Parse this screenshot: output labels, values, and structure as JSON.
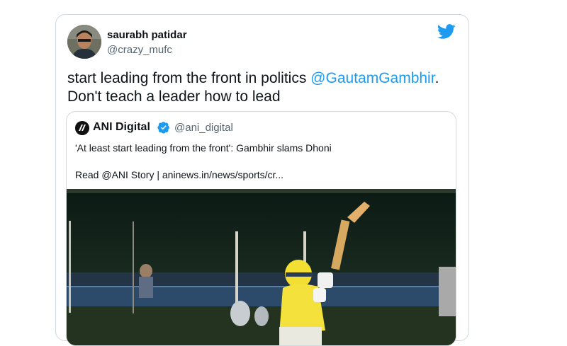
{
  "tweet": {
    "author_name": "saurabh patidar",
    "author_handle": "@crazy_mufc",
    "text_before": "start leading from the front in politics ",
    "mention": "@GautamGambhir",
    "text_after": ". Don't teach a leader how to lead",
    "logo_icon": "twitter-bird-icon",
    "accent_color": "#1d9bf0"
  },
  "quote": {
    "author_name": "ANI Digital",
    "verified_icon": "verified-badge-icon",
    "author_handle": "@ani_digital",
    "text": "'At least start leading from the front': Gambhir slams Dhoni",
    "link_text": "Read @ANI Story | aninews.in/news/sports/cr..."
  }
}
